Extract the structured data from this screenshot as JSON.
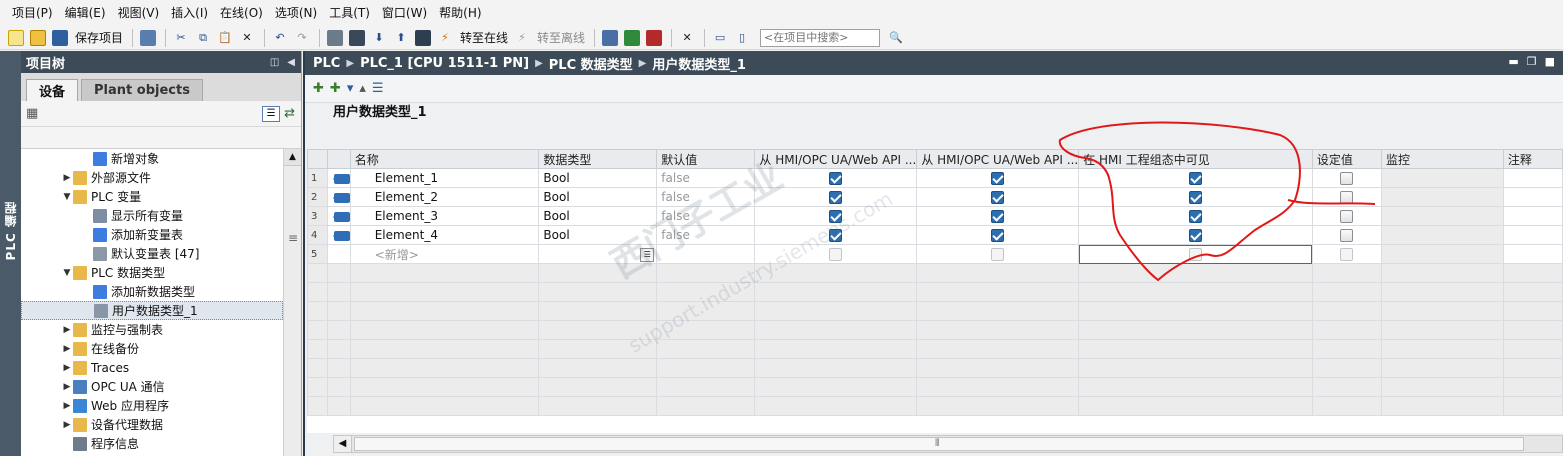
{
  "menu": [
    "项目(P)",
    "编辑(E)",
    "视图(V)",
    "插入(I)",
    "在线(O)",
    "选项(N)",
    "工具(T)",
    "窗口(W)",
    "帮助(H)"
  ],
  "toolbar": {
    "save_label": "保存项目",
    "go_online_label": "转至在线",
    "go_offline_label": "转至离线",
    "search_placeholder": "<在项目中搜索>"
  },
  "left_strip": {
    "label": "PLC 编程"
  },
  "project_tree": {
    "header": "项目树",
    "tabs": [
      "设备",
      "Plant objects"
    ],
    "items": [
      {
        "label": "新增对象",
        "level": 2,
        "arrow": "",
        "icon": "add-object-icon"
      },
      {
        "label": "外部源文件",
        "level": 1,
        "arrow": "▶",
        "icon": "folder-icon"
      },
      {
        "label": "PLC 变量",
        "level": 1,
        "arrow": "▼",
        "icon": "folder-icon"
      },
      {
        "label": "显示所有变量",
        "level": 2,
        "arrow": "",
        "icon": "show-tags-icon"
      },
      {
        "label": "添加新变量表",
        "level": 2,
        "arrow": "",
        "icon": "add-tag-table-icon"
      },
      {
        "label": "默认变量表 [47]",
        "level": 2,
        "arrow": "",
        "icon": "tag-table-icon"
      },
      {
        "label": "PLC 数据类型",
        "level": 1,
        "arrow": "▼",
        "icon": "folder-icon"
      },
      {
        "label": "添加新数据类型",
        "level": 2,
        "arrow": "",
        "icon": "add-data-type-icon"
      },
      {
        "label": "用户数据类型_1",
        "level": 2,
        "arrow": "",
        "icon": "data-type-icon",
        "selected": true
      },
      {
        "label": "监控与强制表",
        "level": 1,
        "arrow": "▶",
        "icon": "folder-icon"
      },
      {
        "label": "在线备份",
        "level": 1,
        "arrow": "▶",
        "icon": "folder-icon"
      },
      {
        "label": "Traces",
        "level": 1,
        "arrow": "▶",
        "icon": "folder-icon"
      },
      {
        "label": "OPC UA 通信",
        "level": 1,
        "arrow": "▶",
        "icon": "opc-ua-icon"
      },
      {
        "label": "Web 应用程序",
        "level": 1,
        "arrow": "▶",
        "icon": "web-app-icon"
      },
      {
        "label": "设备代理数据",
        "level": 1,
        "arrow": "▶",
        "icon": "folder-icon"
      },
      {
        "label": "程序信息",
        "level": 1,
        "arrow": "",
        "icon": "program-info-icon"
      }
    ]
  },
  "breadcrumb": [
    "PLC",
    "PLC_1 [CPU 1511-1 PN]",
    "PLC 数据类型",
    "用户数据类型_1"
  ],
  "editor": {
    "title": "用户数据类型_1",
    "columns": [
      "名称",
      "数据类型",
      "默认值",
      "从 HMI/OPC UA/Web API ...",
      "从 HMI/OPC UA/Web API ...",
      "在 HMI 工程组态中可见",
      "设定值",
      "监控",
      "注释"
    ],
    "rows": [
      {
        "num": "1",
        "name": "Element_1",
        "type": "Bool",
        "default": "false",
        "hmi_access": true,
        "hmi_write": true,
        "hmi_visible": true,
        "setpoint": false
      },
      {
        "num": "2",
        "name": "Element_2",
        "type": "Bool",
        "default": "false",
        "hmi_access": true,
        "hmi_write": true,
        "hmi_visible": true,
        "setpoint": false
      },
      {
        "num": "3",
        "name": "Element_3",
        "type": "Bool",
        "default": "false",
        "hmi_access": true,
        "hmi_write": true,
        "hmi_visible": true,
        "setpoint": false
      },
      {
        "num": "4",
        "name": "Element_4",
        "type": "Bool",
        "default": "false",
        "hmi_access": true,
        "hmi_write": true,
        "hmi_visible": true,
        "setpoint": false
      }
    ],
    "new_row": {
      "num": "5",
      "placeholder": "<新增>"
    }
  },
  "watermark": {
    "line1": "西门子工业",
    "line2": "support.industry.siemens.com"
  },
  "colors": {
    "header_bar": "#3d4b58",
    "checkbox_checked": "#2c6fb0",
    "annotation_red": "#e01818"
  }
}
